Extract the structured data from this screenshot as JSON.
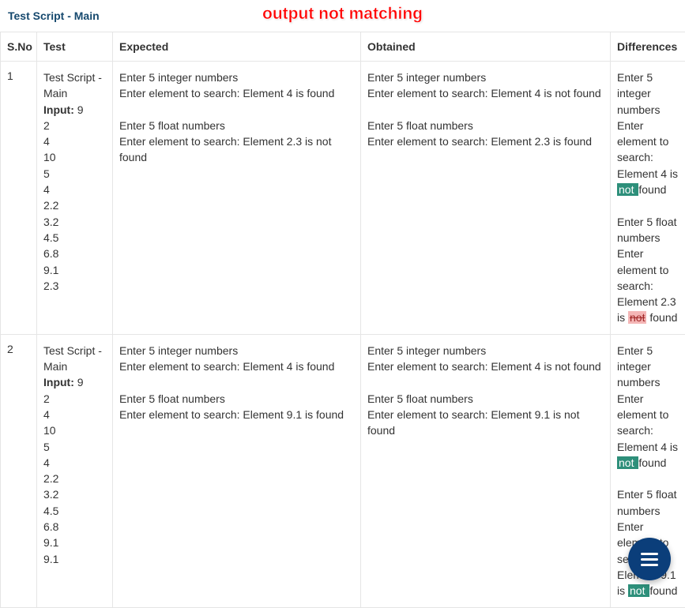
{
  "header": {
    "title": "Test Script - Main",
    "overlay": "output not matching"
  },
  "table": {
    "columns": [
      "S.No",
      "Test",
      "Expected",
      "Obtained",
      "Differences"
    ],
    "rows": [
      {
        "sno": "1",
        "test_name": "Test Script - Main",
        "input_label": "Input:",
        "input_first": "9",
        "input_rest": "2\n4\n10\n5\n4\n2.2\n3.2\n4.5\n6.8\n9.1\n2.3",
        "expected": "Enter 5 integer numbers\nEnter element to search: Element 4 is found\n\nEnter 5 float numbers\nEnter element to search: Element 2.3 is not found",
        "obtained": "Enter 5 integer numbers\nEnter element to search: Element 4 is not found\n\nEnter 5 float numbers\nEnter element to search: Element 2.3 is found",
        "diff": {
          "part1_pre": "Enter 5 integer numbers\nEnter element to search: Element 4 is ",
          "part1_ins": "not ",
          "part1_post": "found",
          "gap": "\n\n",
          "part2_pre": "Enter 5 float numbers\nEnter element to search: Element 2.3 is ",
          "part2_del": "not",
          "part2_post": " found"
        }
      },
      {
        "sno": "2",
        "test_name": "Test Script - Main",
        "input_label": "Input:",
        "input_first": "9",
        "input_rest": "2\n4\n10\n5\n4\n2.2\n3.2\n4.5\n6.8\n9.1\n9.1",
        "expected": "Enter 5 integer numbers\nEnter element to search: Element 4 is found\n\nEnter 5 float numbers\nEnter element to search: Element 9.1 is found",
        "obtained": "Enter 5 integer numbers\nEnter element to search: Element 4 is not found\n\nEnter 5 float numbers\nEnter element to search: Element 9.1 is not found",
        "diff": {
          "part1_pre": "Enter 5 integer numbers\nEnter element to search: Element 4 is ",
          "part1_ins": "not ",
          "part1_post": "found",
          "gap": "\n\n",
          "part2_pre": "Enter 5 float numbers\nEnter element to search: Element 9.1 is ",
          "part2_ins2": "not ",
          "part2_post": "found"
        }
      }
    ]
  }
}
